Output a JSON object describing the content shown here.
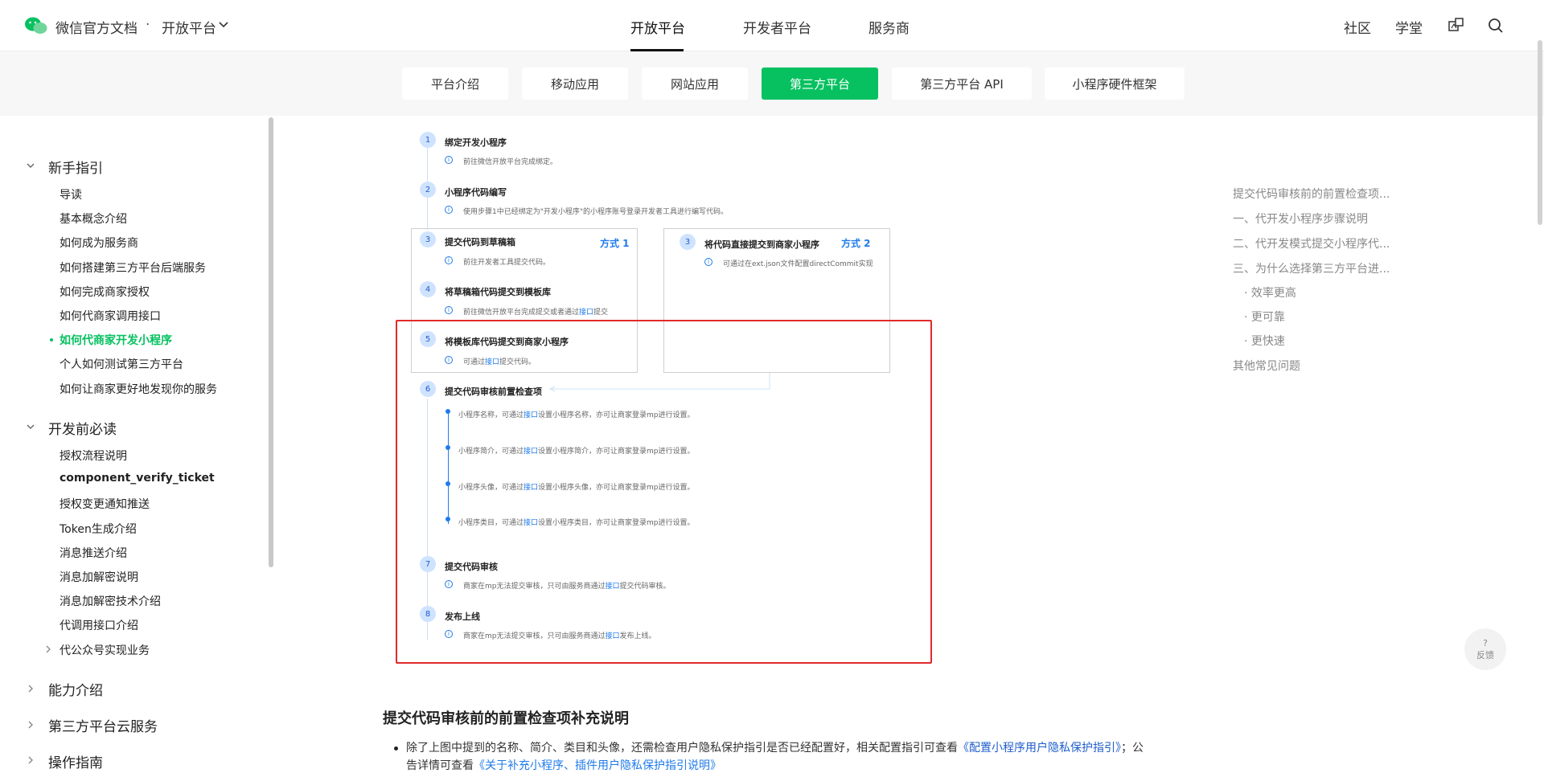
{
  "header": {
    "brand": "微信官方文档",
    "dot": "·",
    "brand_sub": "开放平台",
    "nav": [
      "开放平台",
      "开发者平台",
      "服务商"
    ],
    "links": [
      "社区",
      "学堂"
    ]
  },
  "categories": [
    "平台介绍",
    "移动应用",
    "网站应用",
    "第三方平台",
    "第三方平台 API",
    "小程序硬件框架"
  ],
  "sidebar": {
    "sec1": "新手指引",
    "sec1_items": [
      "导读",
      "基本概念介绍",
      "如何成为服务商",
      "如何搭建第三方平台后端服务",
      "如何完成商家授权",
      "如何代商家调用接口",
      "如何代商家开发小程序",
      "个人如何测试第三方平台",
      "如何让商家更好地发现你的服务"
    ],
    "sec2": "开发前必读",
    "sec2_items": [
      "授权流程说明",
      "component_verify_ticket",
      "授权变更通知推送",
      "Token生成介绍",
      "消息推送介绍",
      "消息加解密说明",
      "消息加解密技术介绍",
      "代调用接口介绍",
      "代公众号实现业务"
    ],
    "sec3": "能力介绍",
    "sec4": "第三方平台云服务",
    "sec5": "操作指南"
  },
  "diagram": {
    "s1_num": "1",
    "s1_title": "绑定开发小程序",
    "s1_desc": "前往微信开放平台完成绑定。",
    "s2_num": "2",
    "s2_title": "小程序代码编写",
    "s2_desc": "使用步骤1中已经绑定为\"开发小程序\"的小程序账号登录开发者工具进行编写代码。",
    "s3a_num": "3",
    "s3a_title": "提交代码到草稿箱",
    "s3a_desc": "前往开发者工具提交代码。",
    "mode1": "方式 1",
    "s4_num": "4",
    "s4_title": "将草稿箱代码提交到模板库",
    "s4_desc": "前往微信开放平台完成提交或者通过",
    "s4_link": "接口",
    "s4_desc2": "提交",
    "s5_num": "5",
    "s5_title": "将模板库代码提交到商家小程序",
    "s5_desc": "可通过",
    "s5_link": "接口",
    "s5_desc2": "提交代码。",
    "s3b_num": "3",
    "s3b_title": "将代码直接提交到商家小程序",
    "s3b_desc": "可通过在ext.json文件配置directCommit实现",
    "mode2": "方式 2",
    "s6_num": "6",
    "s6_title": "提交代码审核前置检查项",
    "checks": [
      {
        "pre": "小程序名称，可通过",
        "link": "接口",
        "post": "设置小程序名称，亦可让商家登录mp进行设置。"
      },
      {
        "pre": "小程序简介，可通过",
        "link": "接口",
        "post": "设置小程序简介，亦可让商家登录mp进行设置。"
      },
      {
        "pre": "小程序头像，可通过",
        "link": "接口",
        "post": "设置小程序头像，亦可让商家登录mp进行设置。"
      },
      {
        "pre": "小程序类目，可通过",
        "link": "接口",
        "post": "设置小程序类目，亦可让商家登录mp进行设置。"
      }
    ],
    "s7_num": "7",
    "s7_title": "提交代码审核",
    "s7_desc": "商家在mp无法提交审核，只可由服务商通过",
    "s7_link": "接口",
    "s7_desc2": "提交代码审核。",
    "s8_num": "8",
    "s8_title": "发布上线",
    "s8_desc": "商家在mp无法提交审核，只可由服务商通过",
    "s8_link": "接口",
    "s8_desc2": "发布上线。",
    "info": "i"
  },
  "article": {
    "title": "提交代码审核前的前置检查项补充说明",
    "p1_pre": "除了上图中提到的名称、简介、类目和头像，还需检查用户隐私保护指引是否已经配置好，相关配置指引可查看",
    "p1_link": "《配置小程序用户隐私保护指引》",
    "p1_post": "；公",
    "p2_pre": "告详情可查看",
    "p2_link": "《关于补充小程序、插件用户隐私保护指引说明》"
  },
  "toc": [
    "提交代码审核前的前置检查项...",
    "一、代开发小程序步骤说明",
    "二、代开发模式提交小程序代...",
    "三、为什么选择第三方平台进...",
    "· 效率更高",
    "· 更可靠",
    "· 更快速",
    "其他常见问题"
  ],
  "feedback": {
    "q": "?",
    "label": "反馈"
  },
  "colors": {
    "accent": "#07c160",
    "link": "#1f7bea",
    "highlight": "#e02a2a"
  }
}
